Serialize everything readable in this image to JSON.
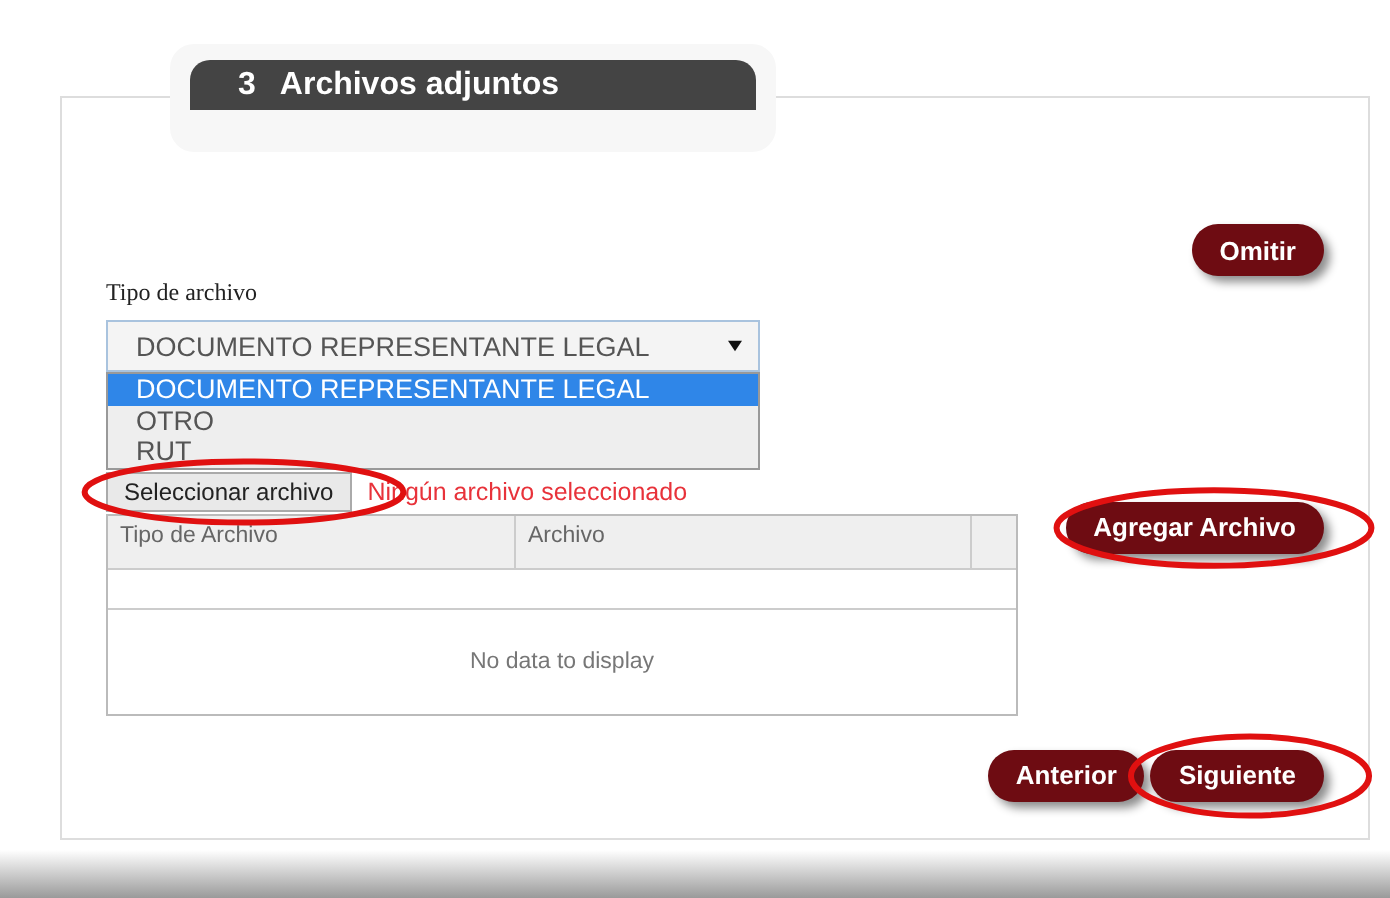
{
  "section": {
    "number": "3",
    "title": "Archivos adjuntos"
  },
  "skip_button": "Omitir",
  "file_type": {
    "label": "Tipo de archivo",
    "value": "DOCUMENTO REPRESENTANTE LEGAL",
    "options": [
      {
        "label": "DOCUMENTO REPRESENTANTE LEGAL",
        "selected": true
      },
      {
        "label": "OTRO",
        "selected": false
      },
      {
        "label": "RUT",
        "selected": false
      }
    ]
  },
  "file_picker": {
    "button": "Seleccionar archivo",
    "status": "Ningún archivo seleccionado",
    "highlighted": true
  },
  "add_button": {
    "label": "Agregar Archivo",
    "highlighted": true
  },
  "table": {
    "columns": [
      "Tipo de Archivo",
      "Archivo"
    ],
    "empty_message": "No data to display"
  },
  "nav_buttons": [
    {
      "label": "Anterior",
      "highlighted": false
    },
    {
      "label": "Siguiente",
      "highlighted": true
    }
  ]
}
